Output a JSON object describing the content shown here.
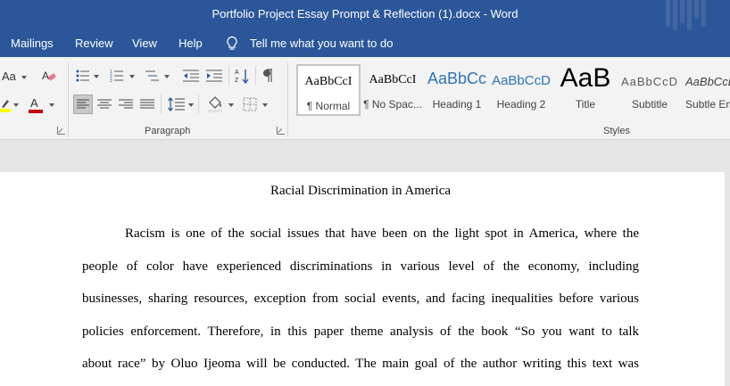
{
  "window": {
    "title": "Portfolio Project Essay Prompt & Reflection (1).docx  -  Word"
  },
  "tabs": [
    "Mailings",
    "Review",
    "View",
    "Help"
  ],
  "tell_me": "Tell me what you want to do",
  "ribbon": {
    "font_group": {
      "case_label": "Aa"
    },
    "paragraph": {
      "group_label": "Paragraph"
    },
    "styles": {
      "group_label": "Styles",
      "items": [
        {
          "preview": "AaBbCcI",
          "name": "¶ Normal"
        },
        {
          "preview": "AaBbCcI",
          "name": "¶ No Spac..."
        },
        {
          "preview": "AaBbCc",
          "name": "Heading 1"
        },
        {
          "preview": "AaBbCcD",
          "name": "Heading 2"
        },
        {
          "preview": "AaB",
          "name": "Title"
        },
        {
          "preview": "AaBbCcD",
          "name": "Subtitle"
        },
        {
          "preview": "AaBbCcD",
          "name": "Subtle Em"
        }
      ]
    }
  },
  "colors": {
    "word_blue": "#2b579a",
    "style_heading": "#2e74b5",
    "highlight_yellow": "#ffff00",
    "font_color_red": "#c00000"
  },
  "document": {
    "title": "Racial Discrimination in America",
    "lines": [
      "Racism is one of the social issues that have been on the light spot in America, where the",
      "people of color have experienced discriminations in various level of the economy, including",
      "businesses, sharing resources, exception from social events, and facing inequalities before various",
      "policies enforcement. Therefore, in this paper theme analysis of the book “So you want to talk",
      "about race” by Oluo Ijeoma will be conducted. The main goal of the author writing this text was"
    ]
  }
}
